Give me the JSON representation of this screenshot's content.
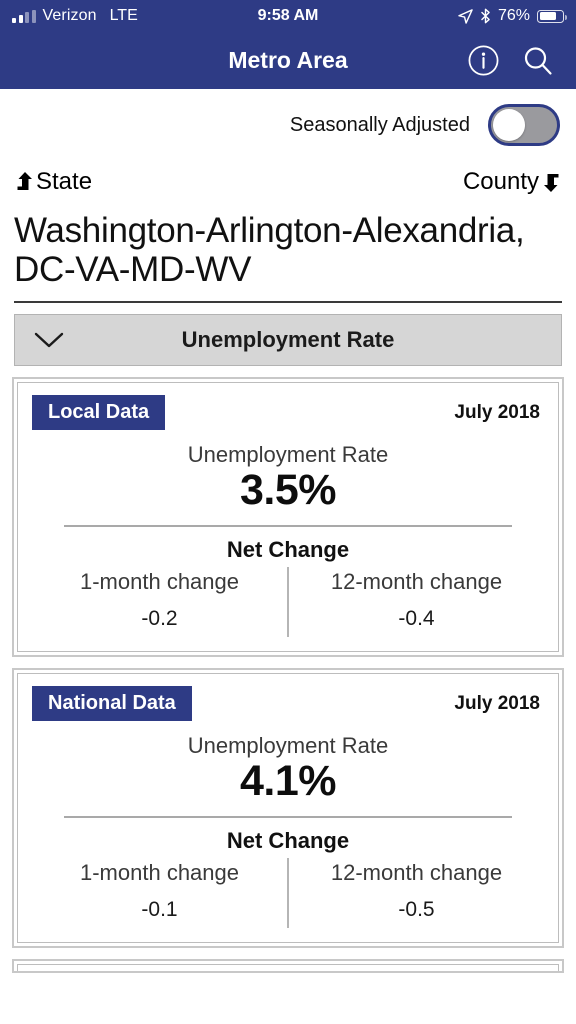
{
  "status_bar": {
    "carrier": "Verizon",
    "network": "LTE",
    "time": "9:58 AM",
    "battery_percent": "76%",
    "location_icon": "location-arrow-icon",
    "bluetooth_icon": "bluetooth-icon",
    "battery_icon": "battery-icon",
    "signal_icon": "signal-bars-icon"
  },
  "nav": {
    "title": "Metro Area",
    "info_icon": "info-circle-icon",
    "search_icon": "search-icon"
  },
  "adjust": {
    "label": "Seasonally Adjusted",
    "toggle_state": "off"
  },
  "geo_nav": {
    "up_label": "State",
    "up_icon": "arrow-up-left-hook-icon",
    "down_label": "County",
    "down_icon": "arrow-down-right-hook-icon"
  },
  "area": {
    "title": "Washington-Arlington-Alexandria, DC-VA-MD-WV"
  },
  "dropdown": {
    "label": "Unemployment Rate",
    "chevron_icon": "chevron-down-icon"
  },
  "colors": {
    "navy": "#2e3b85",
    "bar_gray": "#d6d6d6",
    "card_border": "#c8c8c8"
  },
  "cards": [
    {
      "badge": "Local Data",
      "date": "July 2018",
      "metric_label": "Unemployment Rate",
      "metric_value": "3.5%",
      "net_change_title": "Net Change",
      "changes": [
        {
          "label": "1-month change",
          "value": "-0.2"
        },
        {
          "label": "12-month change",
          "value": "-0.4"
        }
      ]
    },
    {
      "badge": "National Data",
      "date": "July 2018",
      "metric_label": "Unemployment Rate",
      "metric_value": "4.1%",
      "net_change_title": "Net Change",
      "changes": [
        {
          "label": "1-month change",
          "value": "-0.1"
        },
        {
          "label": "12-month change",
          "value": "-0.5"
        }
      ]
    }
  ]
}
